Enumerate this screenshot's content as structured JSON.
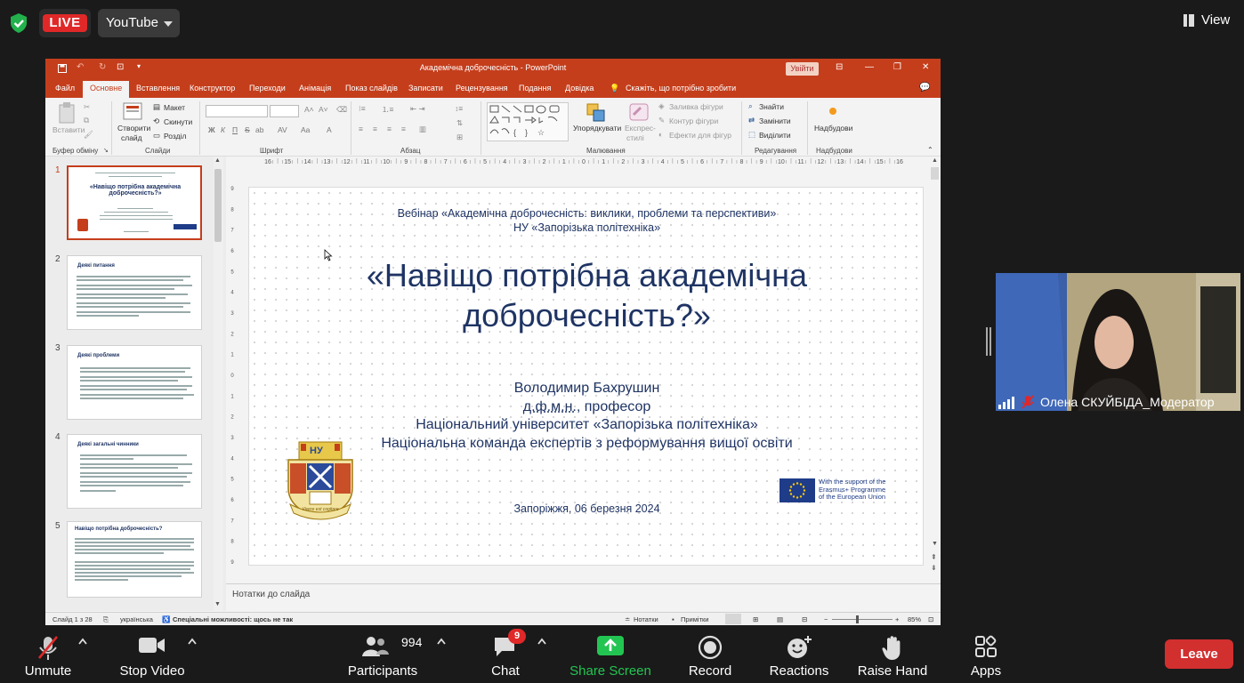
{
  "zoom": {
    "live_label": "LIVE",
    "stream_target": "YouTube",
    "view_label": "View",
    "participant_name": "Олена СКУЙБІДА_Модератор",
    "toolbar": {
      "unmute": "Unmute",
      "stop_video": "Stop Video",
      "participants": "Participants",
      "participants_count": "994",
      "chat": "Chat",
      "chat_badge": "9",
      "share_screen": "Share Screen",
      "record": "Record",
      "reactions": "Reactions",
      "raise_hand": "Raise Hand",
      "apps": "Apps",
      "leave": "Leave"
    },
    "colors": {
      "live": "#e02828",
      "share": "#23c552",
      "leave": "#d22f2f"
    }
  },
  "ppt": {
    "window_title": "Академічна доброчесність  -  PowerPoint",
    "signin": "Увійти",
    "tabs": [
      "Файл",
      "Основне",
      "Вставлення",
      "Конструктор",
      "Переходи",
      "Анімація",
      "Показ слайдів",
      "Записати",
      "Рецензування",
      "Подання",
      "Довідка"
    ],
    "tell_me": "Скажіть, що потрібно зробити",
    "ribbon": {
      "paste": "Вставити",
      "clipboard": "Буфер обміну",
      "new_slide_1": "Створити",
      "new_slide_2": "слайд",
      "layout": "Макет",
      "reset": "Скинути",
      "section": "Розділ",
      "slides": "Слайди",
      "font_bold": "Ж",
      "font_italic": "К",
      "font_underline": "П",
      "font_strike": "S",
      "font_shadow": "ab",
      "font_spacing": "AV",
      "font_case": "Aa",
      "font_group": "Шрифт",
      "paragraph": "Абзац",
      "arrange": "Упорядкувати",
      "quick_styles_1": "Експрес-",
      "quick_styles_2": "стилі",
      "shape_fill": "Заливка фігури",
      "shape_outline": "Контур фігури",
      "shape_effects": "Ефекти для фігур",
      "drawing": "Малювання",
      "find": "Знайти",
      "replace": "Замінити",
      "select": "Виділити",
      "editing": "Редагування",
      "addins": "Надбудови",
      "addins_group": "Надбудови"
    },
    "ruler_labels": [
      "16",
      "15",
      "14",
      "13",
      "12",
      "11",
      "10",
      "9",
      "8",
      "7",
      "6",
      "5",
      "4",
      "3",
      "2",
      "1",
      "0",
      "1",
      "2",
      "3",
      "4",
      "5",
      "6",
      "7",
      "8",
      "9",
      "10",
      "11",
      "12",
      "13",
      "14",
      "15",
      "16"
    ],
    "thumbnails": [
      {
        "num": "1",
        "title": "«Навіщо потрібна академічна доброчесність?»"
      },
      {
        "num": "2",
        "title": "Деякі питання"
      },
      {
        "num": "3",
        "title": "Деякі проблеми"
      },
      {
        "num": "4",
        "title": "Деякі загальні чинники"
      },
      {
        "num": "5",
        "title": "Навіщо потрібна доброчесність?"
      }
    ],
    "slide": {
      "event_line1": "Вебінар «Академічна доброчесність: виклики, проблеми та перспективи»",
      "event_line2": "НУ «Запорізька політехніка»",
      "title_line1": "«Навіщо потрібна академічна",
      "title_line2": "доброчесність?»",
      "author": "Володимир Бахрушин",
      "degree_abbr": "д.ф.м.н.",
      "degree_rest": ", професор",
      "org1": "Національний університет «Запорізька політехніка»",
      "org2": "Національна команда експертів з реформування вищої освіти",
      "place_date": "Запоріжжя, 06 березня 2024",
      "eu_line1": "With the support of the",
      "eu_line2": "Erasmus+ Programme",
      "eu_line3": "of the European Union",
      "crest_letters": "НУ",
      "crest_ribbon": "Vivere est cogitare"
    },
    "notes_placeholder": "Нотатки до слайда",
    "status": {
      "slide_of": "Слайд 1 з 28",
      "language": "українська",
      "accessibility": "Спеціальні можливості: щось не так",
      "notes": "Нотатки",
      "comments": "Примітки",
      "zoom": "85%"
    }
  }
}
